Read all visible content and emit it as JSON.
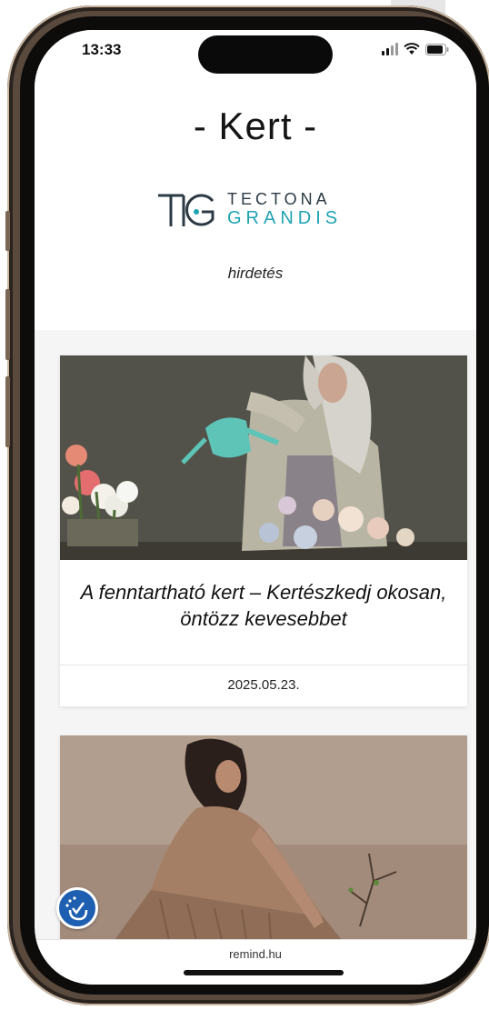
{
  "status_bar": {
    "time": "13:33"
  },
  "header": {
    "title": "- Kert -",
    "brand_line1": "TECTONA",
    "brand_line2": "GRANDIS",
    "brand_mark": "TG",
    "ad_label": "hirdetés"
  },
  "articles": [
    {
      "title": "A fenntartható kert – Kertészkedj okosan, öntözz kevesebbet",
      "date": "2025.05.23.",
      "image": "woman-watering-flowers-photo"
    },
    {
      "title": "",
      "date": "",
      "image": "woman-kneeling-with-branch-photo"
    }
  ],
  "accessibility": {
    "icon": "accessibility-icon",
    "color": "#1f5fb1"
  },
  "browser": {
    "url": "remind.hu"
  },
  "colors": {
    "brand_teal": "#1fa3b4",
    "brand_dark": "#2c3a44",
    "phone_frame": "#5a4a3e"
  }
}
